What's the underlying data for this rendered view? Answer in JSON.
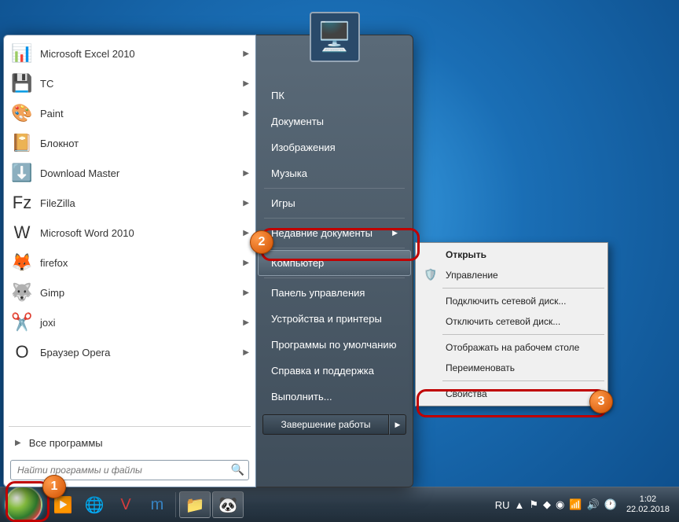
{
  "apps": [
    {
      "label": "Microsoft Excel 2010",
      "icon": "📊",
      "iconName": "excel-icon",
      "arrow": true
    },
    {
      "label": "TC",
      "icon": "💾",
      "iconName": "tc-icon",
      "arrow": true
    },
    {
      "label": "Paint",
      "icon": "🎨",
      "iconName": "paint-icon",
      "arrow": true
    },
    {
      "label": "Блокнот",
      "icon": "📔",
      "iconName": "notepad-icon",
      "arrow": false
    },
    {
      "label": "Download Master",
      "icon": "⬇️",
      "iconName": "download-master-icon",
      "arrow": true
    },
    {
      "label": "FileZilla",
      "icon": "Fz",
      "iconName": "filezilla-icon",
      "arrow": true
    },
    {
      "label": "Microsoft Word 2010",
      "icon": "W",
      "iconName": "word-icon",
      "arrow": true
    },
    {
      "label": "firefox",
      "icon": "🦊",
      "iconName": "firefox-icon",
      "arrow": true
    },
    {
      "label": "Gimp",
      "icon": "🐺",
      "iconName": "gimp-icon",
      "arrow": true
    },
    {
      "label": "joxi",
      "icon": "✂️",
      "iconName": "joxi-icon",
      "arrow": true
    },
    {
      "label": "Браузер Opera",
      "icon": "O",
      "iconName": "opera-icon",
      "arrow": true
    }
  ],
  "allPrograms": "Все программы",
  "searchPlaceholder": "Найти программы и файлы",
  "rightLinks": {
    "user": "ПК",
    "items1": [
      "Документы",
      "Изображения",
      "Музыка"
    ],
    "items2": [
      "Игры"
    ],
    "recent": "Недавние документы",
    "computer": "Компьютер",
    "items3": [
      "Панель управления",
      "Устройства и принтеры",
      "Программы по умолчанию",
      "Справка и поддержка",
      "Выполнить..."
    ]
  },
  "shutdown": "Завершение работы",
  "context": {
    "open": "Открыть",
    "manage": "Управление",
    "mapDrive": "Подключить сетевой диск...",
    "disconnectDrive": "Отключить сетевой диск...",
    "showDesktop": "Отображать на рабочем столе",
    "rename": "Переименовать",
    "properties": "Свойства"
  },
  "tray": {
    "lang": "RU",
    "time": "1:02",
    "date": "22.02.2018"
  }
}
